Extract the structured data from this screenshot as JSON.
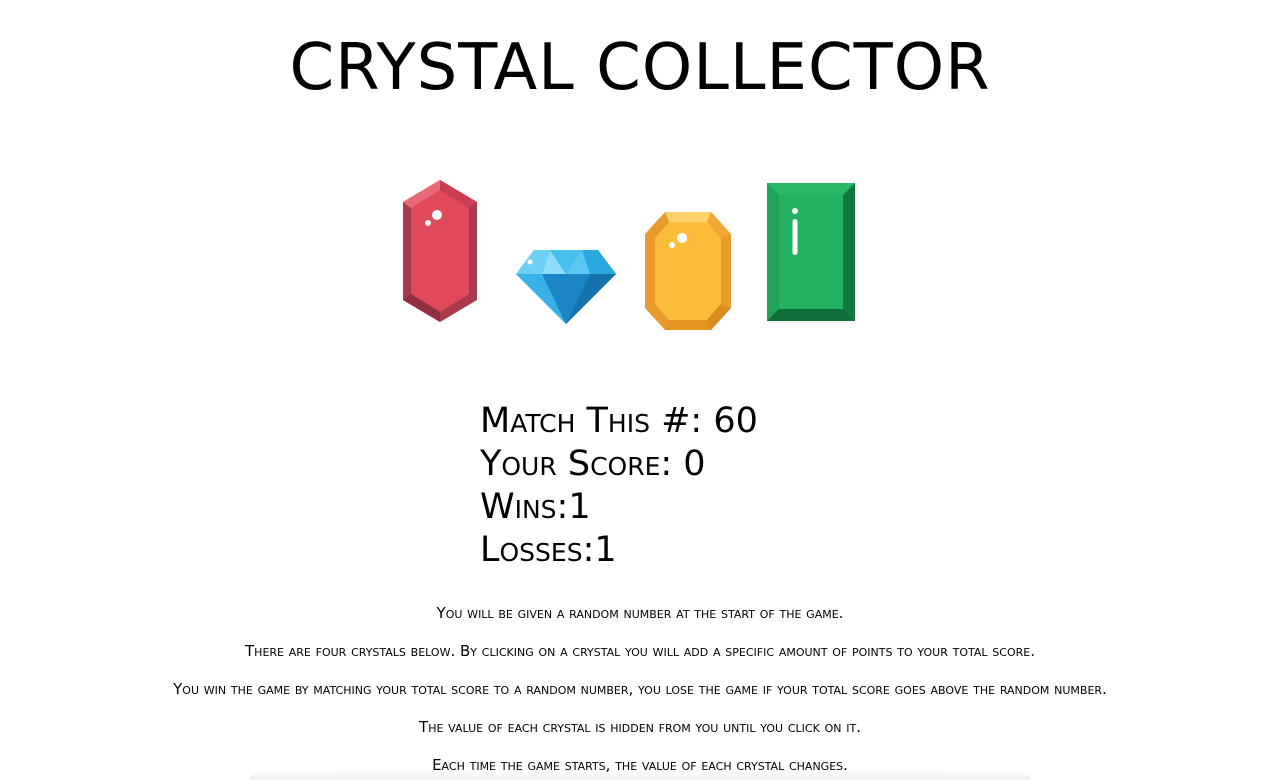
{
  "header": {
    "title": "CRYSTAL COLLECTOR"
  },
  "crystals": [
    {
      "name": "red",
      "color": "#e0495a",
      "icon": "red-crystal-icon"
    },
    {
      "name": "blue",
      "color": "#2aa8e0",
      "icon": "blue-diamond-icon"
    },
    {
      "name": "yellow",
      "color": "#fbbd3a",
      "icon": "yellow-crystal-icon"
    },
    {
      "name": "green",
      "color": "#1fa35a",
      "icon": "green-crystal-icon"
    }
  ],
  "stats": {
    "match_label": "Match This #: ",
    "match_value": "60",
    "score_label": "Your Score: ",
    "score_value": "0",
    "wins_label": "Wins:",
    "wins_value": "1",
    "losses_label": "Losses:",
    "losses_value": "1"
  },
  "instructions": [
    "You will be given a random number at the start of the game.",
    "There are four crystals below. By clicking on a crystal you will add a specific amount of points to your total score.",
    "You win the game by matching your total score to a random number, you lose the game if your total score goes above the random number.",
    "The value of each crystal is hidden from you until you click on it.",
    "Each time the game starts, the value of each crystal changes."
  ]
}
